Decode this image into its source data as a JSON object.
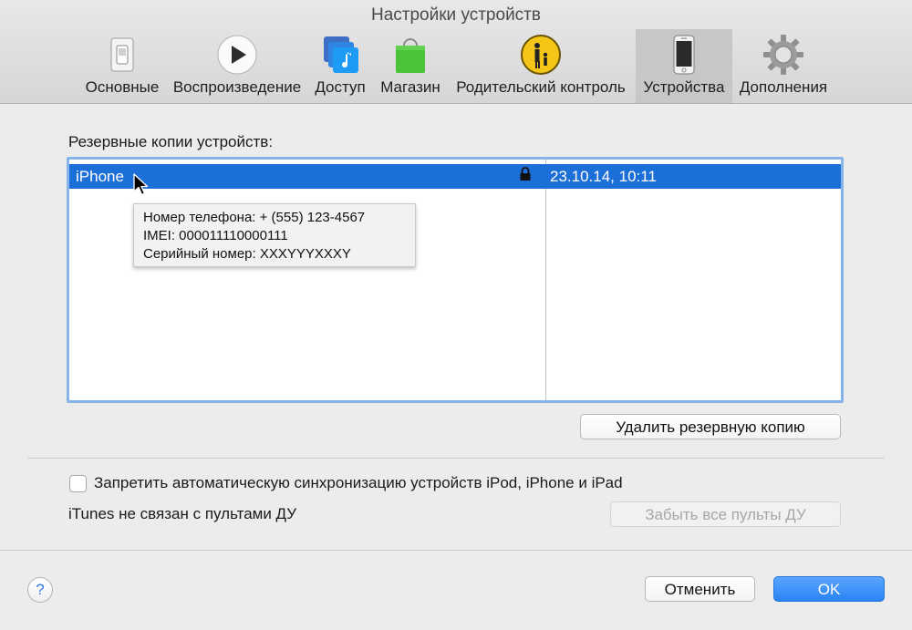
{
  "window": {
    "title": "Настройки устройств"
  },
  "toolbar": {
    "tabs": [
      {
        "label": "Основные",
        "icon": "switch-icon"
      },
      {
        "label": "Воспроизведение",
        "icon": "play-icon"
      },
      {
        "label": "Доступ",
        "icon": "sharing-icon"
      },
      {
        "label": "Магазин",
        "icon": "store-bag-icon"
      },
      {
        "label": "Родительский контроль",
        "icon": "parental-icon"
      },
      {
        "label": "Устройства",
        "icon": "iphone-icon",
        "selected": true
      },
      {
        "label": "Дополнения",
        "icon": "gear-icon"
      }
    ]
  },
  "backups": {
    "label": "Резервные копии устройств:",
    "rows": [
      {
        "name": "iPhone",
        "date": "23.10.14, 10:11",
        "locked": true,
        "selected": true
      }
    ],
    "tooltip": {
      "phone": "Номер телефона: + (555) 123-4567",
      "imei": "IMEI: 000011110000111",
      "serial": "Серийный номер: XXXYYYXXXY"
    },
    "delete_button": "Удалить резервную копию"
  },
  "options": {
    "prevent_sync_label": "Запретить автоматическую синхронизацию устройств iPod, iPhone и iPad",
    "prevent_sync_checked": false,
    "remote_status": "iTunes не связан с пультами ДУ",
    "forget_remotes_button": "Забыть все пульты ДУ"
  },
  "footer": {
    "help": "?",
    "cancel_button": "Отменить",
    "ok_button": "OK"
  },
  "colors": {
    "selection": "#1d6fd8",
    "focus_ring": "#86b3ea",
    "primary_button": "#2a84f4"
  }
}
